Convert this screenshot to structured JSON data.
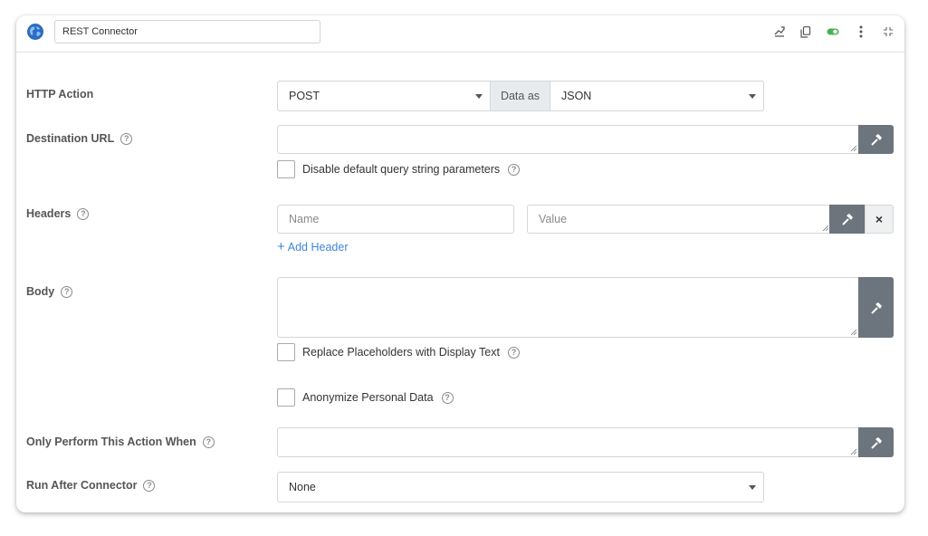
{
  "header": {
    "connector_name": "REST Connector",
    "icons": [
      "globe-icon",
      "usage-icon",
      "copy-icon",
      "toggle-icon",
      "more-vertical-icon",
      "collapse-icon"
    ],
    "toggle_on": true
  },
  "form": {
    "http_action": {
      "label": "HTTP Action",
      "method": "POST",
      "data_as_label": "Data as",
      "format": "JSON"
    },
    "destination_url": {
      "label": "Destination URL",
      "value": "",
      "disable_query_label": "Disable default query string parameters",
      "disable_query_checked": false
    },
    "headers": {
      "label": "Headers",
      "name_placeholder": "Name",
      "value_placeholder": "Value",
      "remove_symbol": "×",
      "add_label": "Add Header"
    },
    "body": {
      "label": "Body",
      "value": "",
      "replace_placeholders_label": "Replace Placeholders with Display Text",
      "anonymize_label": "Anonymize Personal Data"
    },
    "condition": {
      "label": "Only Perform This Action When",
      "value": ""
    },
    "run_after": {
      "label": "Run After Connector",
      "value": "None"
    }
  },
  "colors": {
    "accent": "#3f86d6",
    "wrench_button": "#6c757d",
    "toggle_on": "#4caf50"
  }
}
